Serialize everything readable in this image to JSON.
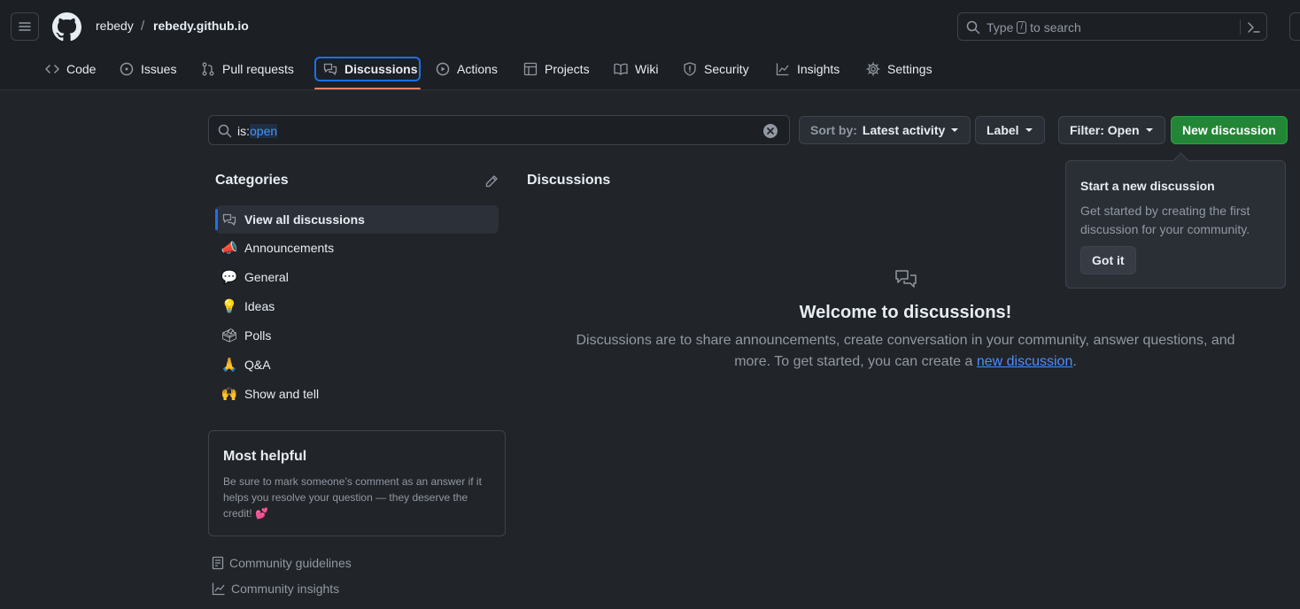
{
  "header": {
    "owner": "rebedy",
    "separator": "/",
    "repo": "rebedy.github.io",
    "search_placeholder_pre": "Type",
    "search_key": "/",
    "search_placeholder_post": "to search"
  },
  "tabs": [
    {
      "label": "Code",
      "icon": "code-icon"
    },
    {
      "label": "Issues",
      "icon": "issue-icon"
    },
    {
      "label": "Pull requests",
      "icon": "pull-request-icon"
    },
    {
      "label": "Discussions",
      "icon": "discussion-icon",
      "active": true
    },
    {
      "label": "Actions",
      "icon": "play-icon"
    },
    {
      "label": "Projects",
      "icon": "table-icon"
    },
    {
      "label": "Wiki",
      "icon": "book-icon"
    },
    {
      "label": "Security",
      "icon": "shield-icon"
    },
    {
      "label": "Insights",
      "icon": "graph-icon"
    },
    {
      "label": "Settings",
      "icon": "gear-icon"
    }
  ],
  "toolbar": {
    "filter_keyword": "is:",
    "filter_value": "open",
    "sort_prefix": "Sort by:",
    "sort_value": "Latest activity",
    "label_button": "Label",
    "filter_button": "Filter: Open",
    "new_discussion": "New discussion"
  },
  "sidebar": {
    "title": "Categories",
    "categories": [
      {
        "label": "View all discussions",
        "icon": "discussion-icon",
        "active": true
      },
      {
        "label": "Announcements",
        "emoji": "📣"
      },
      {
        "label": "General",
        "emoji": "💬"
      },
      {
        "label": "Ideas",
        "emoji": "💡"
      },
      {
        "label": "Polls",
        "emoji": "🗳"
      },
      {
        "label": "Q&A",
        "emoji": "🙏"
      },
      {
        "label": "Show and tell",
        "emoji": "🙌"
      }
    ],
    "helpful_title": "Most helpful",
    "helpful_text": "Be sure to mark someone’s comment as an answer if it helps you resolve your question — they deserve the credit!",
    "helpful_emoji": "💕",
    "guidelines": "Community guidelines",
    "insights": "Community insights"
  },
  "main": {
    "title": "Discussions",
    "welcome_title": "Welcome to discussions!",
    "welcome_text_1": "Discussions are to share announcements, create conversation in your community, answer questions, and more. To get started, you can create a",
    "welcome_link": "new discussion",
    "welcome_text_2": "."
  },
  "popover": {
    "title": "Start a new discussion",
    "text": "Get started by creating the first discussion for your community.",
    "button": "Got it"
  },
  "colors": {
    "background": "#212429",
    "header": "#1c1f24",
    "accent": "#1f6feb",
    "primary": "#238636",
    "tab_underline": "#f78166",
    "link": "#4493f8"
  }
}
